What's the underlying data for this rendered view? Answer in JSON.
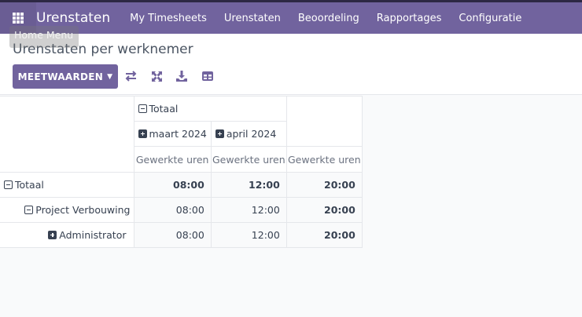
{
  "nav": {
    "brand": "Urenstaten",
    "items": [
      "My Timesheets",
      "Urenstaten",
      "Beoordeling",
      "Rapportages",
      "Configuratie"
    ]
  },
  "tooltip": "Home Menu",
  "page_title": "Urenstaten per werknemer",
  "toolbar": {
    "measures_label": "MEETWAARDEN",
    "icons": [
      "flip-axis-icon",
      "expand-icon",
      "download-icon",
      "insert-spreadsheet-icon"
    ]
  },
  "pivot": {
    "col_total": "Totaal",
    "cols": [
      "maart 2024",
      "april 2024"
    ],
    "measure": "Gewerkte uren",
    "rows": [
      {
        "label": "Totaal",
        "values": [
          "08:00",
          "12:00",
          "20:00"
        ]
      },
      {
        "label": "Project Verbouwing",
        "values": [
          "08:00",
          "12:00",
          "20:00"
        ]
      },
      {
        "label": "Administrator",
        "values": [
          "08:00",
          "12:00",
          "20:00"
        ]
      }
    ]
  },
  "colors": {
    "brand": "#71639e"
  }
}
